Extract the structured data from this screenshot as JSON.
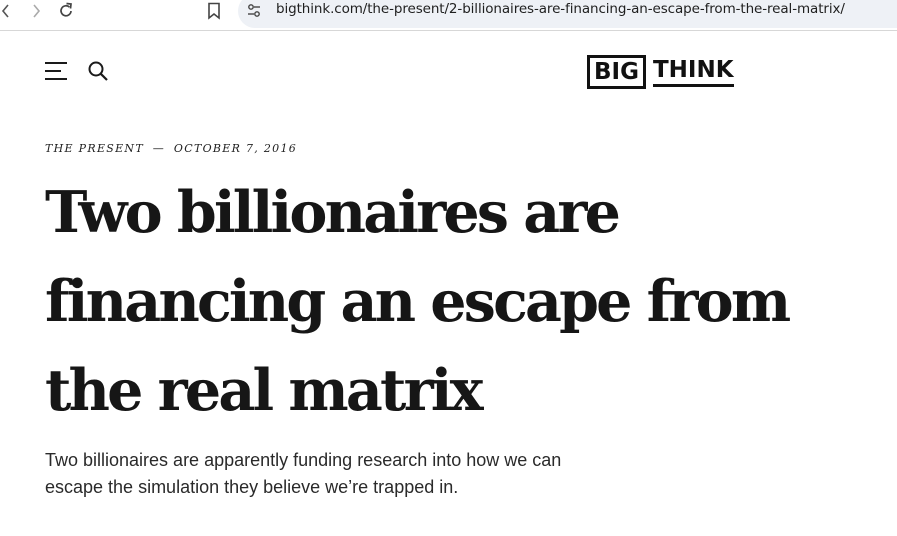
{
  "browser": {
    "url": "bigthink.com/the-present/2-billionaires-are-financing-an-escape-from-the-real-matrix/",
    "icons": [
      "back-icon",
      "forward-icon",
      "reload-icon",
      "bookmark-icon",
      "site-info-icon"
    ]
  },
  "site": {
    "logo_left": "BIG",
    "logo_right": "THINK",
    "menu_icon": "hamburger-menu-icon",
    "search_icon": "search-icon"
  },
  "article": {
    "section": "THE PRESENT",
    "separator": "—",
    "date": "OCTOBER 7, 2016",
    "title": "Two billionaires are financing an escape from the real matrix",
    "summary": "Two billionaires are apparently funding research into how we can escape the simulation they believe we’re trapped in."
  },
  "colors": {
    "text": "#161616",
    "url_bar": "#eef1f6",
    "background": "#ffffff"
  }
}
